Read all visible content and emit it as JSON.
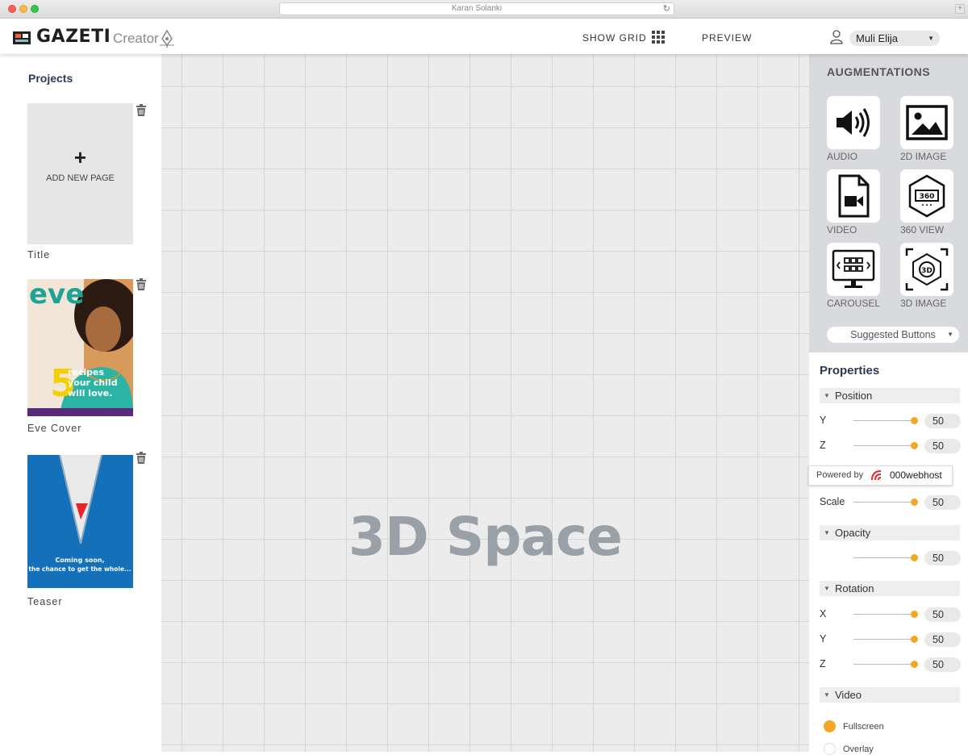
{
  "window": {
    "url_text": "Karan Solanki",
    "reload_glyph": "↻",
    "newtab_glyph": "+"
  },
  "header": {
    "logo_text": "GAZETI",
    "logo_sub": "Creator",
    "show_grid_label": "SHOW GRID",
    "preview_label": "PREVIEW",
    "user_name": "Muli Elija",
    "caret": "▼"
  },
  "left": {
    "title": "Projects",
    "add_plus": "+",
    "add_label": "ADD NEW PAGE",
    "pages": [
      {
        "label": "Title"
      },
      {
        "label": "Eve Cover",
        "cover_brand": "eve",
        "cover_big": "5",
        "cover_headline": [
          "recipes",
          "your child",
          "will love."
        ]
      },
      {
        "label": "Teaser",
        "teaser_lines": [
          "Coming soon,",
          "the chance to get the whole..."
        ]
      }
    ]
  },
  "canvas": {
    "label": "3D Space"
  },
  "augmentations": {
    "title": "AUGMENTATIONS",
    "items": [
      {
        "label": "AUDIO",
        "icon": "speaker-icon"
      },
      {
        "label": "2D IMAGE",
        "icon": "image-icon"
      },
      {
        "label": "VIDEO",
        "icon": "video-file-icon"
      },
      {
        "label": "360 VIEW",
        "icon": "360-view-icon"
      },
      {
        "label": "CAROUSEL",
        "icon": "carousel-icon"
      },
      {
        "label": "3D IMAGE",
        "icon": "3d-image-icon"
      }
    ],
    "suggested_label": "Suggested Buttons",
    "icon_360_text": "360",
    "icon_3d_text": "3D"
  },
  "properties": {
    "title": "Properties",
    "position": {
      "label": "Position",
      "rows": [
        {
          "label": "Y",
          "value": "50"
        },
        {
          "label": "Z",
          "value": "50"
        }
      ]
    },
    "scale": {
      "label": "Scale",
      "value": "50"
    },
    "opacity": {
      "label": "Opacity",
      "value": "50"
    },
    "rotation": {
      "label": "Rotation",
      "rows": [
        {
          "label": "X",
          "value": "50"
        },
        {
          "label": "Y",
          "value": "50"
        },
        {
          "label": "Z",
          "value": "50"
        }
      ]
    },
    "video": {
      "label": "Video",
      "options": [
        {
          "label": "Fullscreen",
          "selected": true
        },
        {
          "label": "Overlay",
          "selected": false
        }
      ]
    },
    "section_glyph": "▼"
  },
  "powered": {
    "by": "Powered by",
    "host": "000webhost"
  },
  "colors": {
    "accent": "#f5a623",
    "canvas_text": "#9aa0a8",
    "panel": "#d9dadd",
    "heading": "#2b3a55"
  }
}
